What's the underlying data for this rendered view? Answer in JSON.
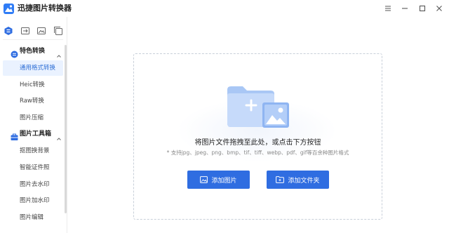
{
  "app": {
    "title": "迅捷图片转换器",
    "logo_icon": "logo-icon",
    "accent_color": "#2f6de1"
  },
  "window_controls": [
    "menu-icon",
    "minimize-icon",
    "maximize-icon",
    "close-icon"
  ],
  "sidebar": {
    "top_icons": [
      "app-switch-icon",
      "image-convert-icon",
      "image-edit-icon",
      "image-copy-icon"
    ],
    "groups": [
      {
        "label": "特色转换",
        "icon": "convert-group-icon",
        "items": [
          "通用格式转换",
          "Heic转换",
          "Raw转换",
          "图片压缩"
        ]
      },
      {
        "label": "图片工具箱",
        "icon": "toolbox-group-icon",
        "items": [
          "抠图换背景",
          "智能证件照",
          "图片去水印",
          "图片加水印",
          "图片编辑"
        ]
      }
    ],
    "active_item": "通用格式转换"
  },
  "main": {
    "drop_title": "将图片文件拖拽至此处，或点击下方按钮",
    "drop_hint": "* 支持jpg、jpeg、png、bmp、tif、tiff、webp、pdf、gif等百余种图片格式",
    "add_image_label": "添加图片",
    "add_folder_label": "添加文件夹"
  }
}
